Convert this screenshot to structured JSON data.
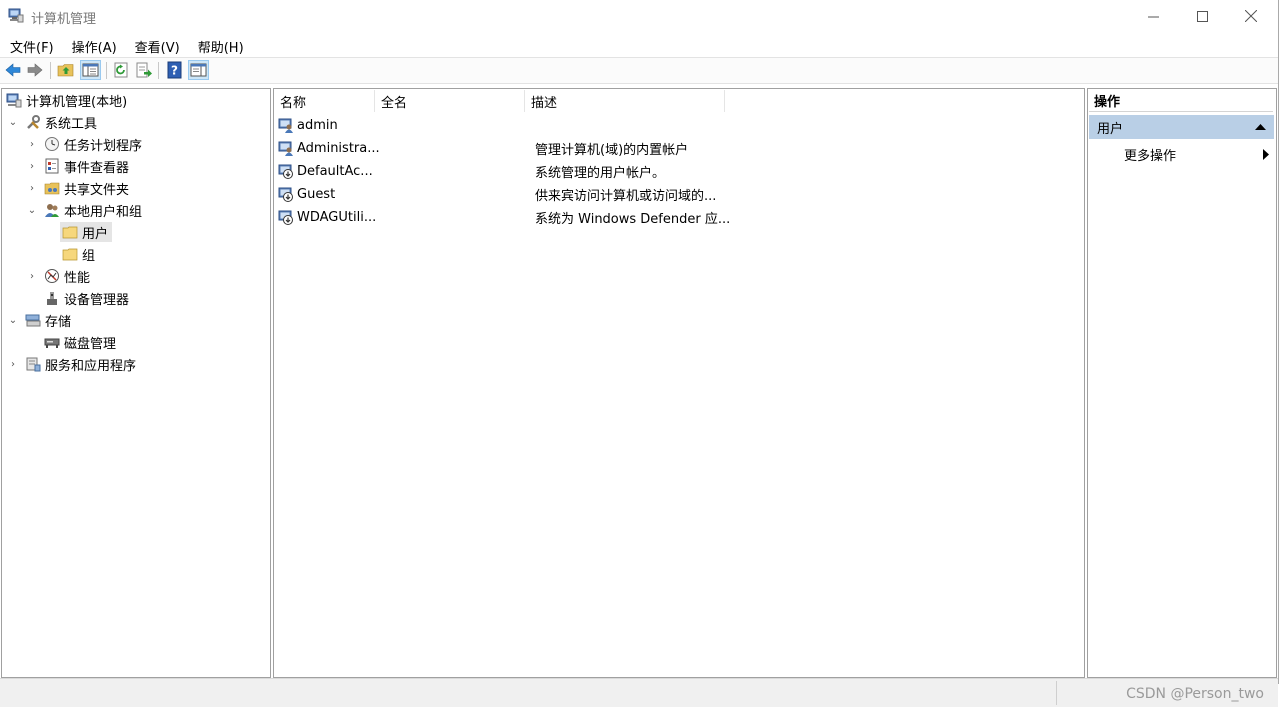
{
  "window": {
    "title": "计算机管理",
    "controls": {
      "minimize": "—",
      "maximize": "☐",
      "close": "✕"
    }
  },
  "menu": [
    "文件(F)",
    "操作(A)",
    "查看(V)",
    "帮助(H)"
  ],
  "toolbar": {
    "icons": [
      "back-arrow-icon",
      "forward-arrow-icon",
      "up-folder-icon",
      "show-hide-tree-icon",
      "refresh-icon",
      "export-list-icon",
      "help-icon",
      "show-hide-action-pane-icon"
    ]
  },
  "tree": {
    "root": "计算机管理(本地)",
    "system_tools": "系统工具",
    "task_scheduler": "任务计划程序",
    "event_viewer": "事件查看器",
    "shared_folders": "共享文件夹",
    "local_users_groups": "本地用户和组",
    "users": "用户",
    "groups": "组",
    "performance": "性能",
    "device_manager": "设备管理器",
    "storage": "存储",
    "disk_management": "磁盘管理",
    "services_apps": "服务和应用程序"
  },
  "list": {
    "columns": [
      "名称",
      "全名",
      "描述"
    ],
    "rows": [
      {
        "name": "admin",
        "full_name": "",
        "description": ""
      },
      {
        "name": "Administra...",
        "full_name": "",
        "description": "管理计算机(域)的内置帐户"
      },
      {
        "name": "DefaultAc...",
        "full_name": "",
        "description": "系统管理的用户帐户。"
      },
      {
        "name": "Guest",
        "full_name": "",
        "description": "供来宾访问计算机或访问域的..."
      },
      {
        "name": "WDAGUtili...",
        "full_name": "",
        "description": "系统为 Windows Defender 应..."
      }
    ]
  },
  "actions": {
    "header": "操作",
    "group": "用户",
    "more": "更多操作"
  },
  "status": {
    "watermark": "CSDN @Person_two"
  },
  "colors": {
    "action_group_bg": "#b9cfe6",
    "selection_bg": "#e5e5e5"
  }
}
